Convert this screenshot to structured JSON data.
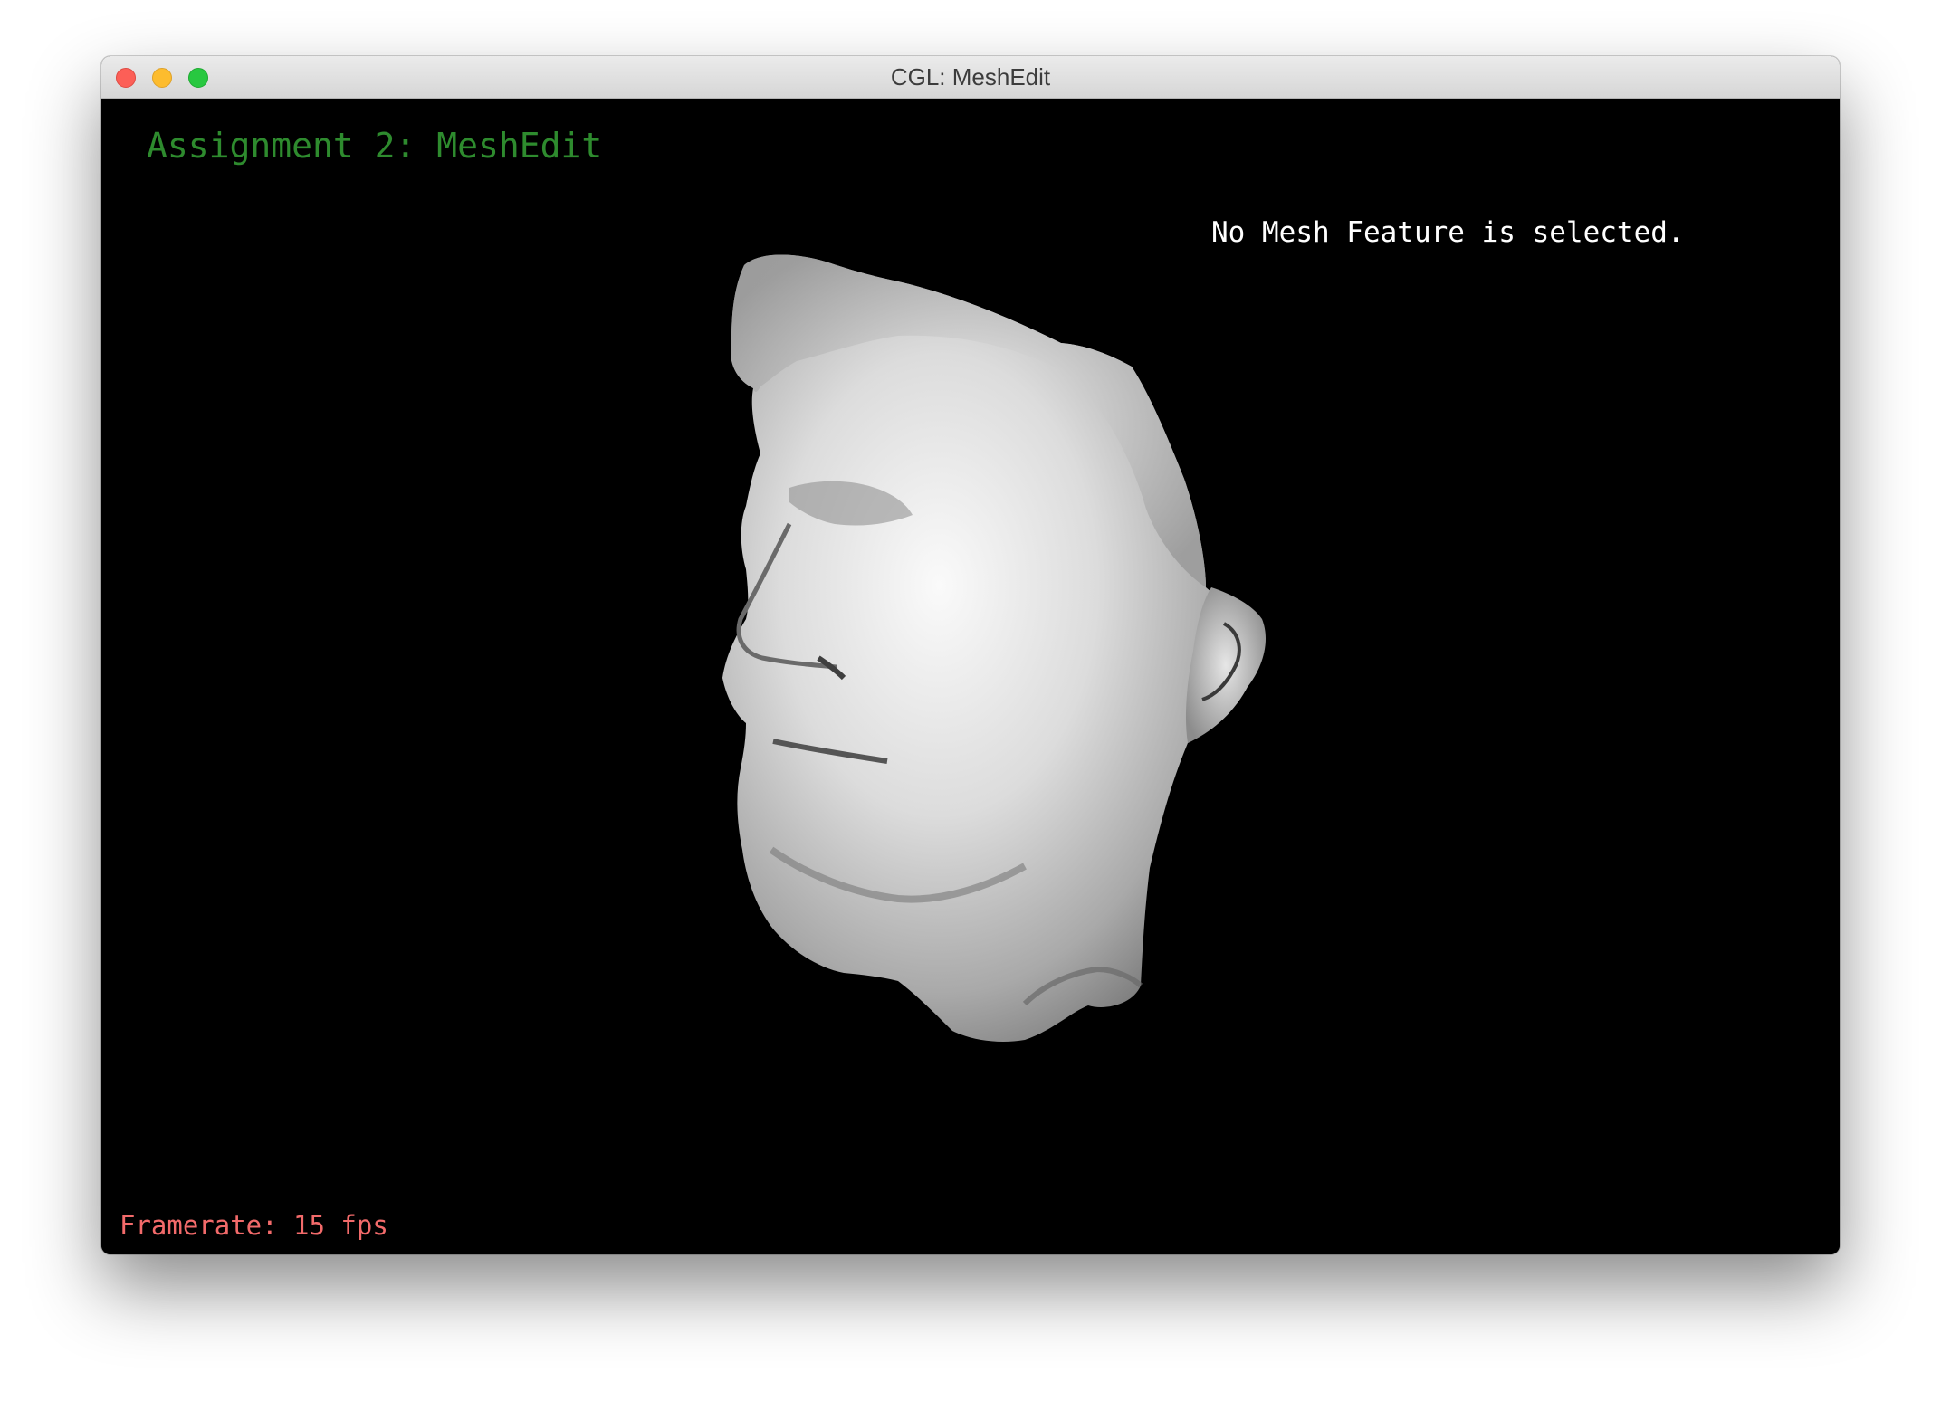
{
  "window": {
    "title": "CGL: MeshEdit"
  },
  "viewport": {
    "assignment_title": "Assignment 2: MeshEdit",
    "selection_status": "No Mesh Feature is selected.",
    "framerate": "Framerate: 15 fps",
    "mesh_model": "head-mesh"
  },
  "colors": {
    "assignment_title": "#2e8b2e",
    "framerate": "#f26a6a",
    "selection_status": "#ffffff",
    "background": "#000000"
  }
}
